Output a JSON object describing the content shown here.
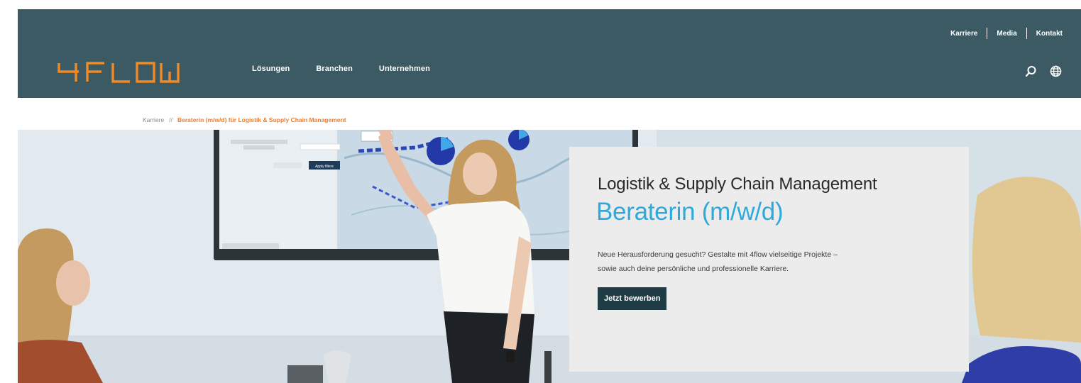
{
  "brand": {
    "logo_text": "4FLOW",
    "header_color": "#3b5a63",
    "logo_color": "#f08a24",
    "accent_color": "#2ea9dc",
    "breadcrumb_active_color": "#f07d2e",
    "button_color": "#203c44"
  },
  "main_nav": {
    "items": [
      {
        "label": "Lösungen"
      },
      {
        "label": "Branchen"
      },
      {
        "label": "Unternehmen"
      }
    ]
  },
  "util_nav": {
    "items": [
      {
        "label": "Karriere"
      },
      {
        "label": "Media"
      },
      {
        "label": "Kontakt"
      }
    ]
  },
  "header_icons": [
    {
      "name": "search-icon"
    },
    {
      "name": "globe-icon"
    }
  ],
  "breadcrumb": {
    "parent": "Karriere",
    "separator": "//",
    "current": "Beraterin (m/w/d) für Logistik & Supply Chain Management"
  },
  "card": {
    "subtitle": "Logistik & Supply Chain Management",
    "title": "Beraterin (m/w/d)",
    "text_line1": "Neue Herausforderung gesucht? Gestalte mit 4flow vielseitige Projekte –",
    "text_line2": "sowie auch deine persönliche und professionelle Karriere.",
    "button_label": "Jetzt bewerben"
  },
  "hero_screen": {
    "apply_button": "Apply filters"
  }
}
